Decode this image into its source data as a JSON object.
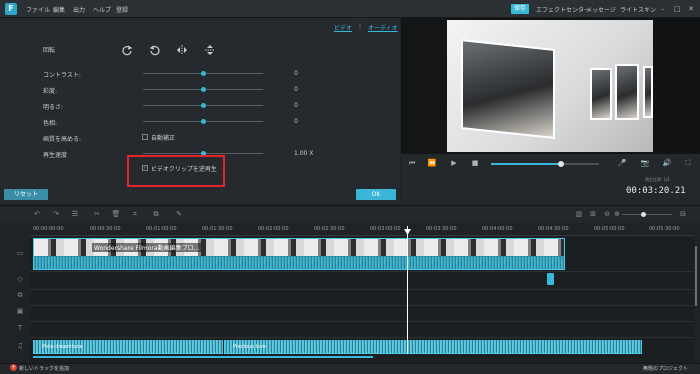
{
  "app": {
    "logo": "F",
    "menu": [
      "ファイル",
      "編集",
      "出力",
      "ヘルプ",
      "登録"
    ],
    "save_label": "保存",
    "right_menu": [
      "エフェクトセンター",
      "メッセージ",
      "ライトスキン"
    ],
    "window_controls": [
      "minimize-icon",
      "maximize-icon",
      "close-icon"
    ]
  },
  "panel": {
    "tabs": {
      "video": "ビデオ",
      "separator": "|",
      "audio": "オーディオ"
    },
    "rotation_label": "回転",
    "rotation_icons": [
      "rotate-cw-icon",
      "rotate-ccw-icon",
      "flip-horizontal-icon",
      "flip-vertical-icon"
    ],
    "adjustments": [
      {
        "label": "コントラスト:",
        "value": "0",
        "level": 0.5
      },
      {
        "label": "彩度:",
        "value": "0",
        "level": 0.5
      },
      {
        "label": "明るさ:",
        "value": "0",
        "level": 0.5
      },
      {
        "label": "色相:",
        "value": "0",
        "level": 0.5
      }
    ],
    "enhance_label": "画質を高める:",
    "auto_enhance": {
      "label": "自動補正",
      "checked": false
    },
    "speed_label": "再生速度",
    "speed_value": "1.00 X",
    "speed_level": 0.5,
    "reverse": {
      "label": "ビデオクリップを逆再生",
      "checked": true,
      "check_glyph": "✓"
    },
    "reset_label": "リセット",
    "ok_label": "OK"
  },
  "preview": {
    "rate_label": "再生比率: 1/1",
    "timecode": "00:03:20.21",
    "progress": 0.65
  },
  "timeline": {
    "ruler_ticks": [
      "00:00:00:00",
      "00:00:30:00",
      "00:01:00:00",
      "00:01:30:00",
      "00:02:00:00",
      "00:02:30:00",
      "00:03:00:00",
      "00:03:30:00",
      "00:04:00:00",
      "00:04:30:00",
      "00:05:00:00",
      "00:05:30:00"
    ],
    "video_clip_title": "Wondershare Filmora動画編集プロ...",
    "audio_clips": [
      {
        "name": "Pixie dreamtune"
      },
      {
        "name": "Precious love"
      }
    ],
    "add_track_label": "新しいトラックを追加",
    "project_name": "無題のプロジェクト"
  },
  "colors": {
    "accent": "#39b7db",
    "highlight": "#e0262a",
    "background": "#1f2326"
  }
}
